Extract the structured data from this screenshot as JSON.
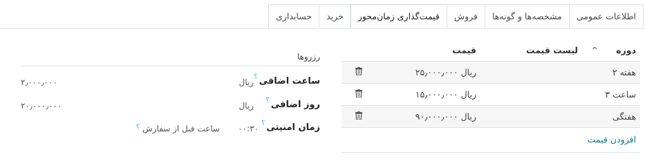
{
  "tabs": [
    {
      "label": "اطلاعات عمومی",
      "active": false
    },
    {
      "label": "مشخصه‌ها و گونه‌ها",
      "active": false
    },
    {
      "label": "فروش",
      "active": false
    },
    {
      "label": "قیمت‌گذاری زمان‌محور",
      "active": true
    },
    {
      "label": "خرید",
      "active": false
    },
    {
      "label": "حسابداری",
      "active": false
    }
  ],
  "reservations": {
    "title": "رزروها",
    "help_mark": "؟",
    "extra_hour": {
      "label": "ساعت اضافی",
      "currency": "ریال",
      "value": "۲٫۰۰۰٫۰۰۰"
    },
    "extra_day": {
      "label": "روز اضافی",
      "currency": "ریال",
      "value": "۲۰٫۰۰۰٫۰۰۰"
    },
    "security_time": {
      "label": "زمان امنیتی",
      "value": "۰۰:۳۰",
      "unit": "ساعت قبل از سفارش"
    }
  },
  "pricing_table": {
    "headers": {
      "period": "دوره",
      "pricelist": "لیست قیمت",
      "price": "قیمت"
    },
    "rows": [
      {
        "period": "۲ هفته",
        "price": "ریال ۲۵٫۰۰۰٫۰۰۰"
      },
      {
        "period": "۳ ساعت",
        "price": "ریال ۱۵٫۰۰۰٫۰۰۰"
      },
      {
        "period": "هفتگی",
        "price": "ریال ۹۰٫۰۰۰٫۰۰۰"
      }
    ],
    "add_label": "افزودن قیمت"
  },
  "colors": {
    "accent": "#017e84",
    "help": "#14b8c4",
    "border": "#dee2e6"
  }
}
